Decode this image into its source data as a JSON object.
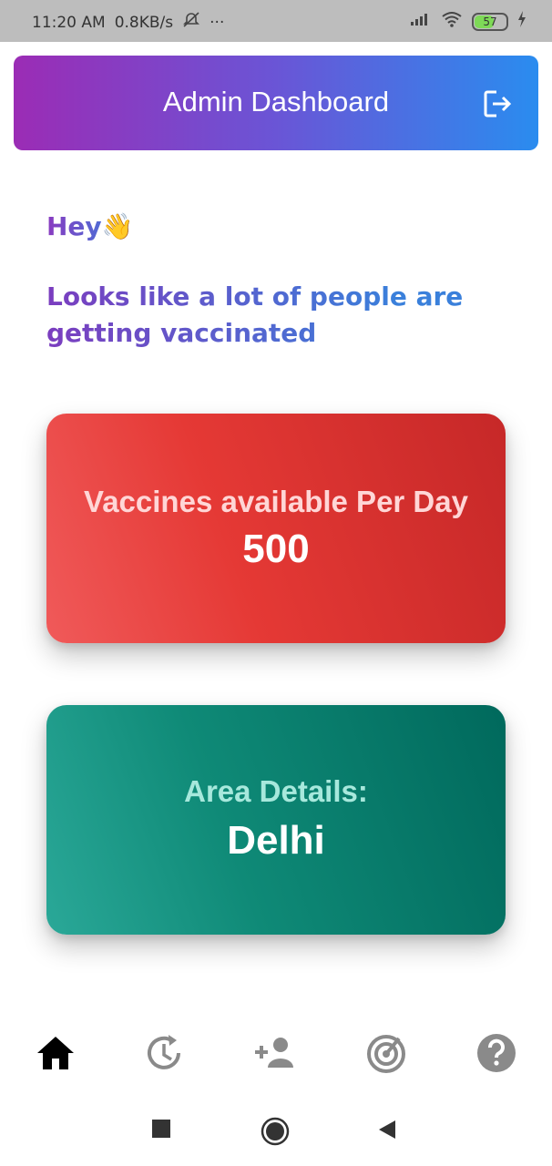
{
  "status_bar": {
    "time": "11:20 AM",
    "speed": "0.8KB/s",
    "dots": "···",
    "battery": "57",
    "icons": [
      "mute-icon",
      "signal-icon",
      "wifi-icon",
      "battery-icon",
      "charging-icon"
    ]
  },
  "header": {
    "title": "Admin Dashboard",
    "logout_icon": "logout-icon"
  },
  "greeting": {
    "hey": "Hey",
    "emoji": "👋",
    "message": "Looks like a lot of people are getting vaccinated"
  },
  "cards": [
    {
      "label": "Vaccines available Per Day",
      "value": "500",
      "color": "#e53935"
    },
    {
      "label": "Area Details:",
      "value": "Delhi",
      "color": "#00796b"
    }
  ],
  "bottom_nav": [
    {
      "icon": "home-icon",
      "active": true
    },
    {
      "icon": "history-icon",
      "active": false
    },
    {
      "icon": "add-person-icon",
      "active": false
    },
    {
      "icon": "radar-icon",
      "active": false
    },
    {
      "icon": "help-icon",
      "active": false
    }
  ],
  "colors": {
    "header_gradient_start": "#9b2cb5",
    "header_gradient_end": "#2a8cef",
    "nav_active": "#000000",
    "nav_inactive": "#8a8a8a"
  }
}
